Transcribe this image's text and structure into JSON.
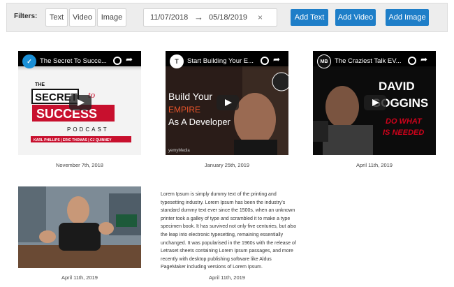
{
  "filters": {
    "label": "Filters:",
    "chips": [
      "Text",
      "Video",
      "Image"
    ],
    "date_from": "11/07/2018",
    "date_arrow": "→",
    "date_to": "05/18/2019",
    "clear_symbol": "×",
    "buttons": {
      "add_text": "Add Text",
      "add_video": "Add Video",
      "add_image": "Add Image"
    }
  },
  "videos": [
    {
      "title": "The Secret To Succe...",
      "channel_icon": "bird-logo-icon",
      "art_top": "THE",
      "art_main1": "SECRET",
      "art_main2": "to",
      "art_main3": "SUCCESS",
      "art_sub": "PODCAST",
      "art_hosts": "KARL PHILLIPS | ERIC THOMAS | CJ QUINNEY",
      "date": "November 7th, 2018",
      "accent": "#c8102e"
    },
    {
      "title": "Start Building Your E...",
      "channel_icon": "t-logo-icon",
      "channel_letter": "T",
      "art_line1": "Build Your",
      "art_line2": "EMPIRE",
      "art_line3": "As A Developer",
      "art_footer": "yemyMedia",
      "date": "January 25th, 2019",
      "accent": "#e8542a"
    },
    {
      "title": "The Craziest Talk EV...",
      "channel_icon": "mb-logo-icon",
      "channel_letter": "MB",
      "art_line1": "DAVID",
      "art_line2": "GOGGINS",
      "art_line3": "DO WHAT",
      "art_line4": "IS NEEDED",
      "date": "April 11th, 2019",
      "accent": "#d0021b"
    }
  ],
  "image_item": {
    "date": "April 11th, 2019"
  },
  "text_item": {
    "body": "Lorem Ipsum is simply dummy text of the printing and typesetting industry. Lorem Ipsum has been the industry's standard dummy text ever since the 1500s, when an unknown printer took a galley of type and scrambled it to make a type specimen book. It has survived not only five centuries, but also the leap into electronic typesetting, remaining essentially unchanged. It was popularised in the 1960s with the release of Letraset sheets containing Lorem Ipsum passages, and more recently with desktop publishing software like Aldus PageMaker including versions of Lorem Ipsum.",
    "date": "April 11th, 2019"
  }
}
